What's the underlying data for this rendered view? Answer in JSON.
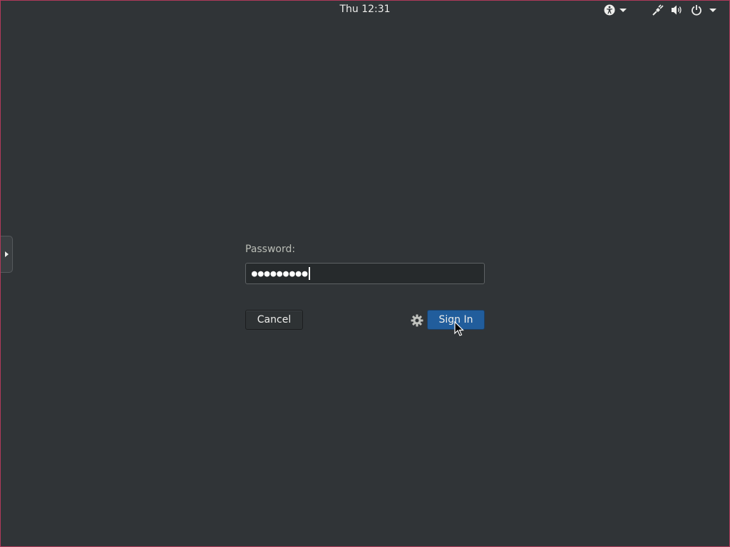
{
  "topbar": {
    "clock": "Thu 12:31",
    "accessibility_icon": "accessibility-icon",
    "network_icon": "wired-network-icon",
    "volume_icon": "volume-icon",
    "power_icon": "power-icon"
  },
  "login": {
    "prompt_label": "Password:",
    "password_value": "●●●●●●●●●",
    "cancel_label": "Cancel",
    "signin_label": "Sign In",
    "session_icon": "gear-icon"
  },
  "colors": {
    "background": "#303437",
    "accent": "#215d9c",
    "text": "#eeeeec"
  }
}
